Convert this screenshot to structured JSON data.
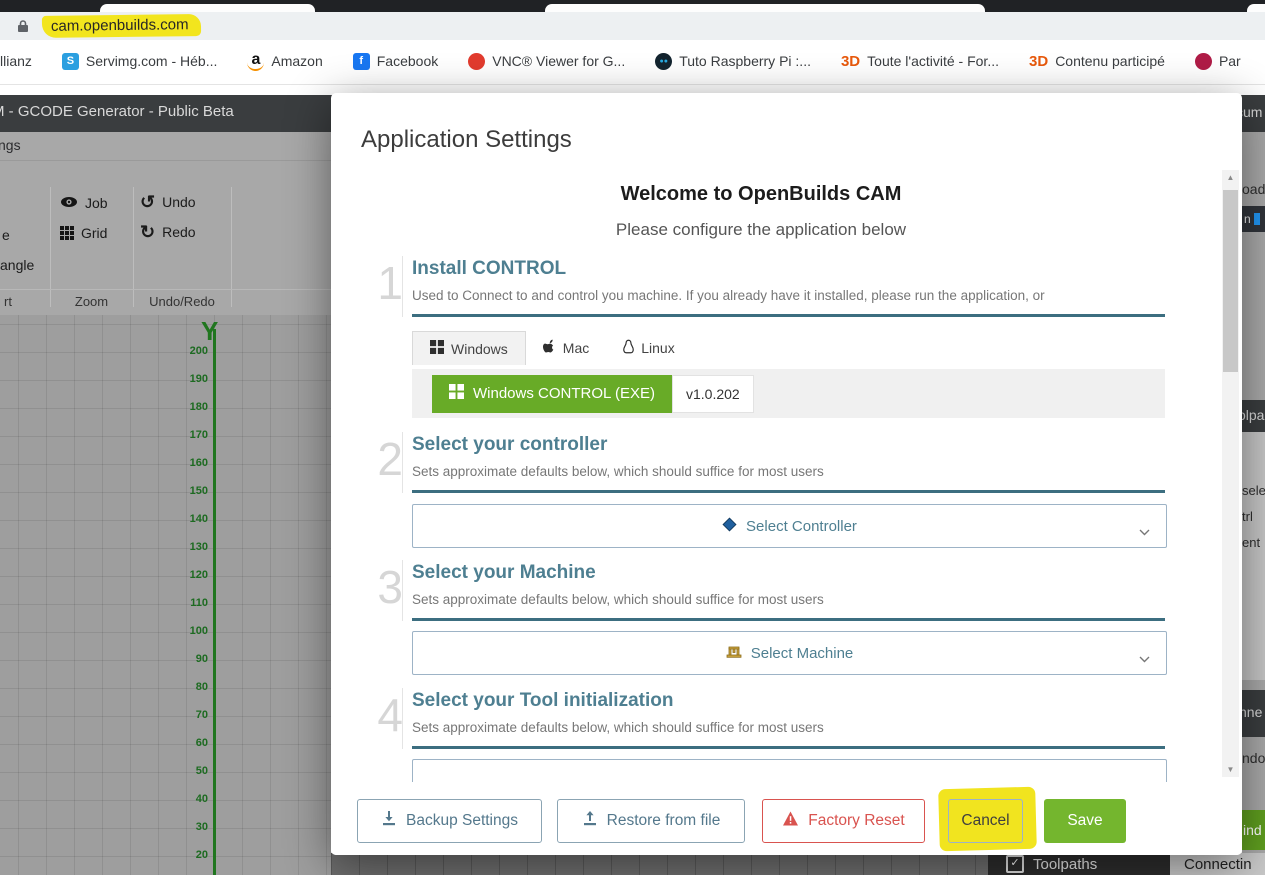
{
  "browser": {
    "url": "cam.openbuilds.com",
    "bookmarks": [
      {
        "name": "allianz",
        "label": "llianz",
        "icon": "allianz-icon",
        "shape": "none",
        "icon_text": "",
        "icon_bg": "",
        "icon_fg": ""
      },
      {
        "name": "servimg",
        "label": "Servimg.com - Héb...",
        "icon": "servimg-icon",
        "shape": "square",
        "icon_text": "S",
        "icon_bg": "#2b9fe0",
        "icon_fg": "#fff"
      },
      {
        "name": "amazon",
        "label": "Amazon",
        "icon": "amazon-icon",
        "shape": "square",
        "icon_text": "a",
        "icon_bg": "",
        "icon_fg": "#111"
      },
      {
        "name": "facebook",
        "label": "Facebook",
        "icon": "facebook-icon",
        "shape": "square",
        "icon_text": "f",
        "icon_bg": "#1877f2",
        "icon_fg": "#fff"
      },
      {
        "name": "vnc",
        "label": "VNC® Viewer for G...",
        "icon": "vnc-viewer-icon",
        "shape": "circle",
        "icon_text": "",
        "icon_bg": "#e23b2e",
        "icon_fg": "#fff"
      },
      {
        "name": "tuto-raspberry",
        "label": "Tuto Raspberry Pi :...",
        "icon": "tuto-raspberry-icon",
        "shape": "circle",
        "icon_text": "●●",
        "icon_bg": "#13242f",
        "icon_fg": "#27aae1"
      },
      {
        "name": "3d-activite",
        "label": "Toute l'activité - For...",
        "icon": "3d-forum-icon",
        "shape": "text",
        "icon_text": "3D",
        "icon_bg": "",
        "icon_fg": "#e8590c"
      },
      {
        "name": "3d-contenu",
        "label": "Contenu participé",
        "icon": "3d-forum-icon",
        "shape": "text",
        "icon_text": "3D",
        "icon_bg": "",
        "icon_fg": "#e8590c"
      },
      {
        "name": "raspberry",
        "label": "Par",
        "icon": "raspberry-pi-icon",
        "shape": "circle",
        "icon_text": "",
        "icon_bg": "#b01c47",
        "icon_fg": "#fff"
      }
    ]
  },
  "app": {
    "title_bar_fragment": "M - GCODE Generator - Public Beta",
    "menu_fragment": "ngs",
    "toolbar": {
      "partial_line1": "e",
      "partial_line2": "angle",
      "partial_group_label": "rt",
      "job_label": "Job",
      "grid_label": "Grid",
      "undo_label": "Undo",
      "redo_label": "Redo",
      "zoom_group_label": "Zoom",
      "history_group_label": "Undo/Redo"
    },
    "canvas": {
      "axis_label": "Y",
      "ticks": [
        200,
        190,
        180,
        170,
        160,
        150,
        140,
        130,
        120,
        110,
        100,
        90,
        80,
        70,
        60,
        50,
        40,
        30,
        20
      ]
    },
    "edge_fragments": {
      "header": "cum",
      "load": "oad",
      "badge": "n",
      "panel": "olpa",
      "f1": "sele",
      "f2": "trl",
      "f3": "ent",
      "f4": "nne",
      "f5": "ndo",
      "f6": "ind"
    },
    "status_bar": {
      "toolpaths": "Toolpaths",
      "connecting": "Connectin"
    }
  },
  "modal": {
    "title": "Application Settings",
    "welcome_title": "Welcome to OpenBuilds CAM",
    "welcome_subtitle": "Please configure the application below",
    "sections": [
      {
        "number": "1",
        "heading": "Install CONTROL",
        "subheading": "Used to Connect to and control you machine. If you already have it installed, please run the application, or"
      },
      {
        "number": "2",
        "heading": "Select your controller",
        "subheading": "Sets approximate defaults below, which should suffice for most users"
      },
      {
        "number": "3",
        "heading": "Select your Machine",
        "subheading": "Sets approximate defaults below, which should suffice for most users"
      },
      {
        "number": "4",
        "heading": "Select your Tool initialization",
        "subheading": "Sets approximate defaults below, which should suffice for most users"
      }
    ],
    "os_tabs": {
      "windows": "Windows",
      "mac": "Mac",
      "linux": "Linux"
    },
    "download_button": "Windows CONTROL (EXE)",
    "version_badge": "v1.0.202",
    "controller_dropdown": "Select Controller",
    "machine_dropdown": "Select Machine",
    "footer": {
      "backup": "Backup Settings",
      "restore": "Restore from file",
      "factory_reset": "Factory Reset",
      "cancel": "Cancel",
      "save": "Save"
    }
  },
  "colors": {
    "accent_green": "#6fae26",
    "heading_teal": "#4e7f91",
    "underline_teal": "#3c6e80",
    "danger_red": "#d9534f",
    "highlight_yellow": "#f1e41f",
    "axis_green": "#20761f"
  }
}
